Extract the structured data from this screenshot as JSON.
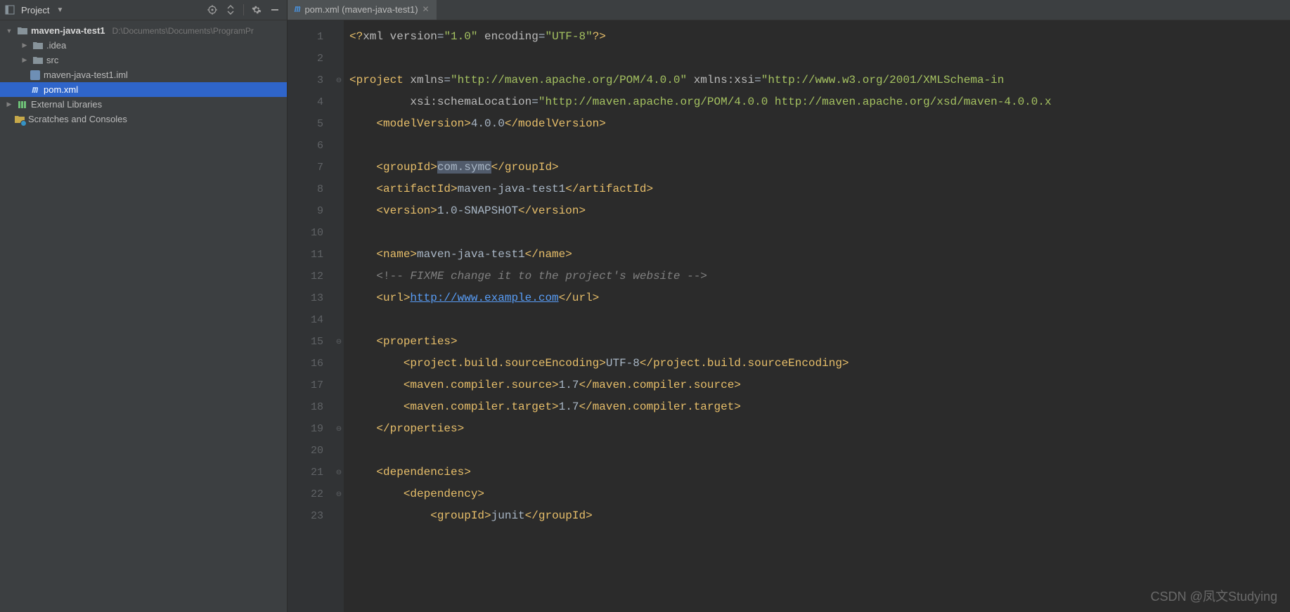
{
  "sidebar": {
    "toolbar_title": "Project",
    "project_name": "maven-java-test1",
    "project_path": "D:\\Documents\\Documents\\ProgramPr",
    "idea_folder": ".idea",
    "src_folder": "src",
    "iml_file": "maven-java-test1.iml",
    "pom_file": "pom.xml",
    "external_libs": "External Libraries",
    "scratches": "Scratches and Consoles"
  },
  "tab": {
    "label": "pom.xml (maven-java-test1)"
  },
  "code": {
    "line1": "<?xml version=\"1.0\" encoding=\"UTF-8\"?>",
    "l3_1": "<project",
    "l3_2": " xmlns",
    "l3_3": "=",
    "l3_4": "\"http://maven.apache.org/POM/4.0.0\"",
    "l3_5": " xmlns:xsi",
    "l3_6": "=",
    "l3_7": "\"http://www.w3.org/2001/XMLSchema-in",
    "l4_1": "         xsi:schemaLocation",
    "l4_2": "=",
    "l4_3": "\"http://maven.apache.org/POM/4.0.0 http://maven.apache.org/xsd/maven-4.0.0.x",
    "l5_o": "<modelVersion>",
    "l5_t": "4.0.0",
    "l5_c": "</modelVersion>",
    "l7_o": "<groupId>",
    "l7_t": "com.symc",
    "l7_c": "</groupId>",
    "l8_o": "<artifactId>",
    "l8_t": "maven-java-test1",
    "l8_c": "</artifactId>",
    "l9_o": "<version>",
    "l9_t": "1.0-SNAPSHOT",
    "l9_c": "</version>",
    "l11_o": "<name>",
    "l11_t": "maven-java-test1",
    "l11_c": "</name>",
    "l12_1": "<!-- ",
    "l12_2": "FIXME change it to the project's website",
    "l12_3": " -->",
    "l13_o": "<url>",
    "l13_t": "http://www.example.com",
    "l13_c": "</url>",
    "l15": "<properties>",
    "l16_o": "<project.build.sourceEncoding>",
    "l16_t": "UTF-8",
    "l16_c": "</project.build.sourceEncoding>",
    "l17_o": "<maven.compiler.source>",
    "l17_t": "1.7",
    "l17_c": "</maven.compiler.source>",
    "l18_o": "<maven.compiler.target>",
    "l18_t": "1.7",
    "l18_c": "</maven.compiler.target>",
    "l19": "</properties>",
    "l21": "<dependencies>",
    "l22": "<dependency>",
    "l23_o": "<groupId>",
    "l23_t": "junit",
    "l23_c": "</groupId>"
  },
  "line_count": 23,
  "watermark": "CSDN @凤文Studying"
}
